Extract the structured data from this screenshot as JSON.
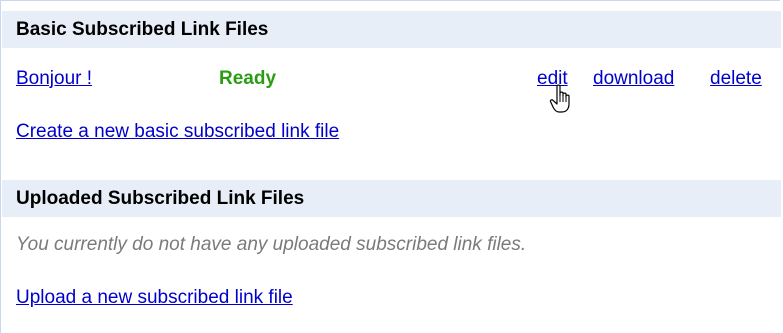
{
  "basic_section": {
    "title": "Basic Subscribed Link Files",
    "files": [
      {
        "name": "Bonjour !",
        "status": "Ready",
        "actions": {
          "edit": "edit",
          "download": "download",
          "delete": "delete"
        }
      }
    ],
    "create_link": "Create a new basic subscribed link file"
  },
  "uploaded_section": {
    "title": "Uploaded Subscribed Link Files",
    "empty_message": "You currently do not have any uploaded subscribed link files.",
    "upload_link": "Upload a new subscribed link file"
  },
  "colors": {
    "header_bg": "#e8eef7",
    "link": "#0000cc",
    "status_ready": "#2a9d13",
    "muted": "#7a7a7a"
  },
  "icons": {
    "cursor": "hand-pointer-icon"
  }
}
